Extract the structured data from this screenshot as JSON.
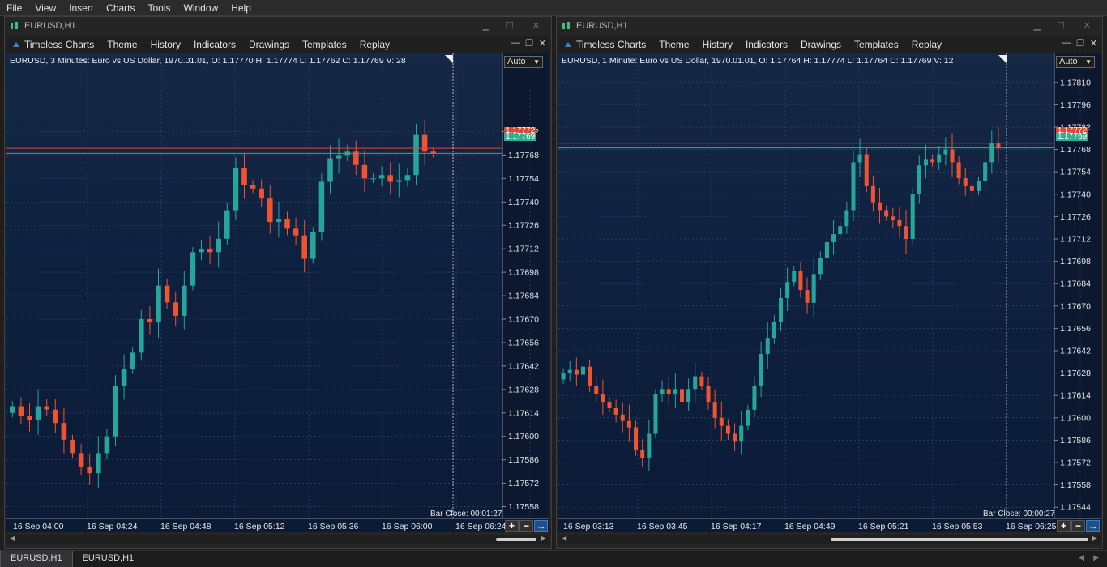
{
  "menu": [
    "File",
    "View",
    "Insert",
    "Charts",
    "Tools",
    "Window",
    "Help"
  ],
  "colors": {
    "bull": "#26a69a",
    "bear": "#ef5331",
    "ask_line": "#e2442f",
    "bid_line": "#2bb090",
    "grid": "#33507a"
  },
  "windows": [
    {
      "title": "EURUSD,H1",
      "toolbar": {
        "brand": "Timeless Charts",
        "items": [
          "Theme",
          "History",
          "Indicators",
          "Drawings",
          "Templates",
          "Replay"
        ]
      },
      "info": "EURUSD, 3 Minutes: Euro vs US Dollar, 1970.01.01, O: 1.17770 H: 1.17774 L: 1.17762 C: 1.17769 V: 28",
      "scale_mode": "Auto",
      "bar_close": "Bar Close: 00:01:27",
      "ask_label": "1.17772",
      "bid_label": "1.17769",
      "y_ticks": [
        "1.17782",
        "1.17768",
        "1.17754",
        "1.17740",
        "1.17726",
        "1.17712",
        "1.17698",
        "1.17684",
        "1.17670",
        "1.17656",
        "1.17642",
        "1.17628",
        "1.17614",
        "1.17600",
        "1.17586",
        "1.17572",
        "1.17558"
      ],
      "x_ticks": [
        "16 Sep 04:00",
        "16 Sep 04:24",
        "16 Sep 04:48",
        "16 Sep 05:12",
        "16 Sep 05:36",
        "16 Sep 06:00",
        "16 Sep 06:24"
      ]
    },
    {
      "title": "EURUSD,H1",
      "toolbar": {
        "brand": "Timeless Charts",
        "items": [
          "Theme",
          "History",
          "Indicators",
          "Drawings",
          "Templates",
          "Replay"
        ]
      },
      "info": "EURUSD, 1 Minute: Euro vs US Dollar, 1970.01.01, O: 1.17764 H: 1.17774 L: 1.17764 C: 1.17769 V: 12",
      "scale_mode": "Auto",
      "bar_close": "Bar Close: 00:00:27",
      "ask_label": "1.17772",
      "bid_label": "1.17769",
      "y_ticks": [
        "1.17810",
        "1.17796",
        "1.17782",
        "1.17768",
        "1.17754",
        "1.17740",
        "1.17726",
        "1.17712",
        "1.17698",
        "1.17684",
        "1.17670",
        "1.17656",
        "1.17642",
        "1.17628",
        "1.17614",
        "1.17600",
        "1.17586",
        "1.17572",
        "1.17558",
        "1.17544"
      ],
      "x_ticks": [
        "16 Sep 03:13",
        "16 Sep 03:45",
        "16 Sep 04:17",
        "16 Sep 04:49",
        "16 Sep 05:21",
        "16 Sep 05:53",
        "16 Sep 06:25"
      ]
    }
  ],
  "buttons": {
    "plus": "+",
    "minus": "−",
    "arrow": "→"
  },
  "tabs": [
    "EURUSD,H1",
    "EURUSD,H1"
  ],
  "chart_data": [
    {
      "type": "candlestick",
      "name": "EURUSD, 3 Minutes",
      "ylim": [
        1.17551,
        1.17819
      ],
      "closes": [
        1.17618,
        1.17612,
        1.1761,
        1.17618,
        1.17616,
        1.17608,
        1.17598,
        1.1759,
        1.17582,
        1.17578,
        1.1759,
        1.176,
        1.1763,
        1.1764,
        1.1765,
        1.1767,
        1.17668,
        1.1769,
        1.1768,
        1.17672,
        1.1769,
        1.1771,
        1.17712,
        1.1771,
        1.17718,
        1.17735,
        1.1776,
        1.1775,
        1.17748,
        1.17742,
        1.17728,
        1.1773,
        1.17724,
        1.1772,
        1.17706,
        1.17722,
        1.17752,
        1.17766,
        1.17768,
        1.1777,
        1.17762,
        1.17754,
        1.17754,
        1.17756,
        1.17752,
        1.17753,
        1.17756,
        1.1778,
        1.1777,
        1.17769
      ]
    },
    {
      "type": "candlestick",
      "name": "EURUSD, 1 Minute",
      "ylim": [
        1.17537,
        1.17818
      ],
      "closes": [
        1.17628,
        1.1763,
        1.17627,
        1.17632,
        1.1762,
        1.17615,
        1.1761,
        1.17606,
        1.17602,
        1.17598,
        1.17594,
        1.1758,
        1.17575,
        1.1759,
        1.17615,
        1.17618,
        1.17615,
        1.17618,
        1.1761,
        1.17618,
        1.17626,
        1.1762,
        1.1761,
        1.176,
        1.17595,
        1.1759,
        1.17585,
        1.17595,
        1.17605,
        1.1762,
        1.1764,
        1.1765,
        1.1766,
        1.17675,
        1.17685,
        1.17692,
        1.1768,
        1.17672,
        1.1769,
        1.177,
        1.1771,
        1.17715,
        1.1772,
        1.1773,
        1.1776,
        1.17765,
        1.17745,
        1.17735,
        1.1773,
        1.17726,
        1.17724,
        1.1772,
        1.17712,
        1.1774,
        1.17758,
        1.17762,
        1.1776,
        1.17765,
        1.17768,
        1.1776,
        1.1775,
        1.17745,
        1.17742,
        1.17748,
        1.1776,
        1.17772,
        1.17769
      ]
    }
  ]
}
